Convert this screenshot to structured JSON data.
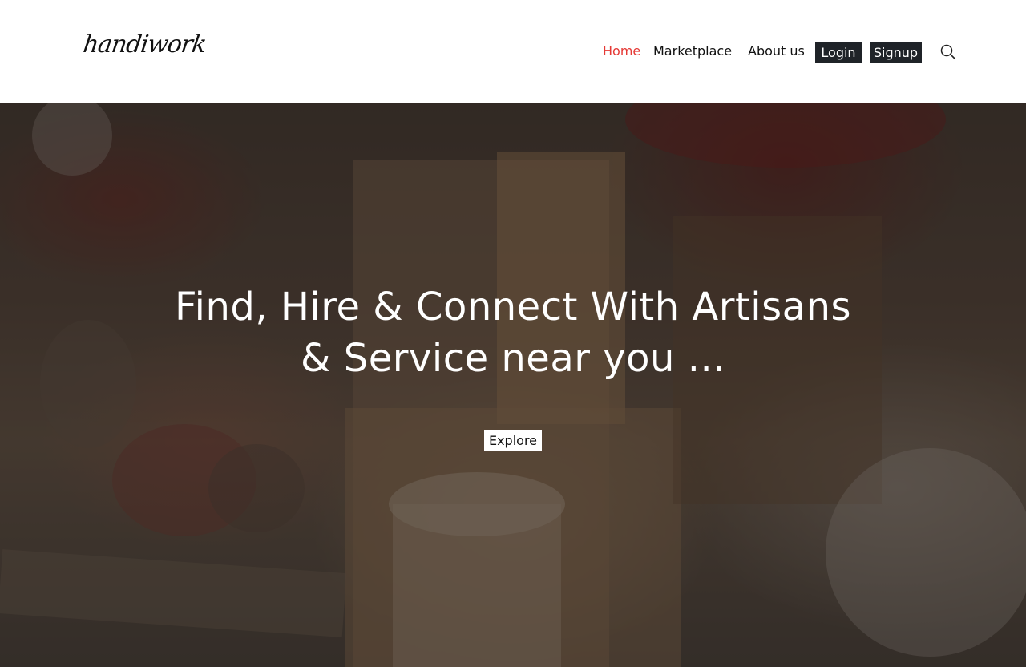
{
  "header": {
    "logo_text": "handiwork",
    "nav": {
      "home": "Home",
      "marketplace": "Marketplace",
      "about": "About us",
      "login": "Login",
      "signup": "Signup"
    },
    "search_icon": "search-icon",
    "active_color": "#e53935",
    "button_color": "#1f2328"
  },
  "hero": {
    "title_line1": "Find, Hire & Connect With Artisans",
    "title_line2": "& Service near you ...",
    "cta_label": "Explore"
  }
}
